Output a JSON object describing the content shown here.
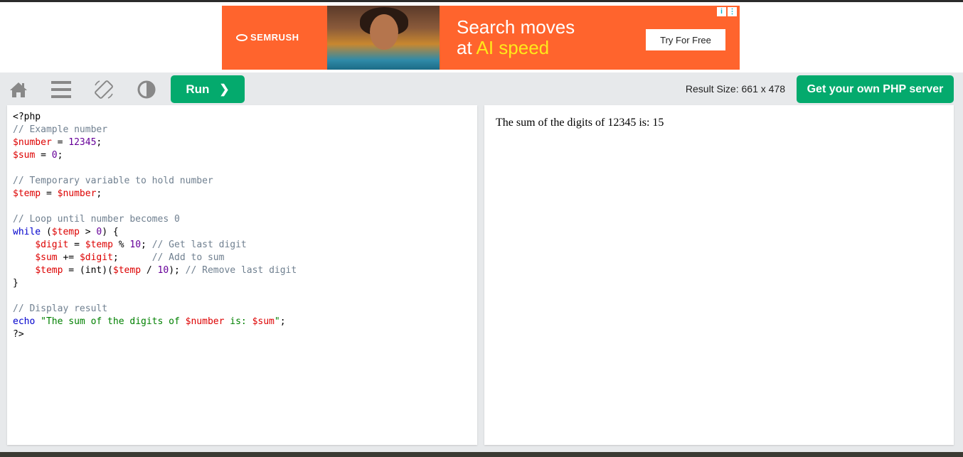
{
  "ad": {
    "brand": "SEMRUSH",
    "headline_line1": "Search moves",
    "headline_prefix": "at ",
    "headline_highlight": "AI speed",
    "cta": "Try For Free",
    "info_icon": "i",
    "menu_icon": "⋮"
  },
  "toolbar": {
    "run_label": "Run",
    "run_chevron": "❯",
    "result_size": "Result Size: 661 x 478",
    "server_label": "Get your own PHP server"
  },
  "editor": {
    "lines": [
      [
        {
          "t": "<?php",
          "c": ""
        }
      ],
      [
        {
          "t": "// Example number",
          "c": "c"
        }
      ],
      [
        {
          "t": "$number",
          "c": "v"
        },
        {
          "t": " = ",
          "c": ""
        },
        {
          "t": "12345",
          "c": "n"
        },
        {
          "t": ";",
          "c": ""
        }
      ],
      [
        {
          "t": "$sum",
          "c": "v"
        },
        {
          "t": " = ",
          "c": ""
        },
        {
          "t": "0",
          "c": "n"
        },
        {
          "t": ";",
          "c": ""
        }
      ],
      [],
      [
        {
          "t": "// Temporary variable to hold number",
          "c": "c"
        }
      ],
      [
        {
          "t": "$temp",
          "c": "v"
        },
        {
          "t": " = ",
          "c": ""
        },
        {
          "t": "$number",
          "c": "v"
        },
        {
          "t": ";",
          "c": ""
        }
      ],
      [],
      [
        {
          "t": "// Loop until number becomes 0",
          "c": "c"
        }
      ],
      [
        {
          "t": "while",
          "c": "k"
        },
        {
          "t": " (",
          "c": ""
        },
        {
          "t": "$temp",
          "c": "v"
        },
        {
          "t": " > ",
          "c": ""
        },
        {
          "t": "0",
          "c": "n"
        },
        {
          "t": ") {",
          "c": ""
        }
      ],
      [
        {
          "t": "    ",
          "c": ""
        },
        {
          "t": "$digit",
          "c": "v"
        },
        {
          "t": " = ",
          "c": ""
        },
        {
          "t": "$temp",
          "c": "v"
        },
        {
          "t": " % ",
          "c": ""
        },
        {
          "t": "10",
          "c": "n"
        },
        {
          "t": "; ",
          "c": ""
        },
        {
          "t": "// Get last digit",
          "c": "c"
        }
      ],
      [
        {
          "t": "    ",
          "c": ""
        },
        {
          "t": "$sum",
          "c": "v"
        },
        {
          "t": " += ",
          "c": ""
        },
        {
          "t": "$digit",
          "c": "v"
        },
        {
          "t": ";      ",
          "c": ""
        },
        {
          "t": "// Add to sum",
          "c": "c"
        }
      ],
      [
        {
          "t": "    ",
          "c": ""
        },
        {
          "t": "$temp",
          "c": "v"
        },
        {
          "t": " = (int)(",
          "c": ""
        },
        {
          "t": "$temp",
          "c": "v"
        },
        {
          "t": " / ",
          "c": ""
        },
        {
          "t": "10",
          "c": "n"
        },
        {
          "t": "); ",
          "c": ""
        },
        {
          "t": "// Remove last digit",
          "c": "c"
        }
      ],
      [
        {
          "t": "}",
          "c": ""
        }
      ],
      [],
      [
        {
          "t": "// Display result",
          "c": "c"
        }
      ],
      [
        {
          "t": "echo",
          "c": "k"
        },
        {
          "t": " ",
          "c": ""
        },
        {
          "t": "\"The sum of the digits of ",
          "c": "s"
        },
        {
          "t": "$number",
          "c": "v"
        },
        {
          "t": " is: ",
          "c": "s"
        },
        {
          "t": "$sum",
          "c": "v"
        },
        {
          "t": "\"",
          "c": "s"
        },
        {
          "t": ";",
          "c": ""
        }
      ],
      [
        {
          "t": "?>",
          "c": ""
        }
      ]
    ]
  },
  "result": {
    "output": "The sum of the digits of 12345 is: 15"
  },
  "colors": {
    "accent": "#04aa6d",
    "ad_bg": "#ff642d",
    "ad_highlight": "#ffe81a"
  },
  "icons": [
    "home-icon",
    "menu-icon",
    "rotate-icon",
    "contrast-icon"
  ]
}
